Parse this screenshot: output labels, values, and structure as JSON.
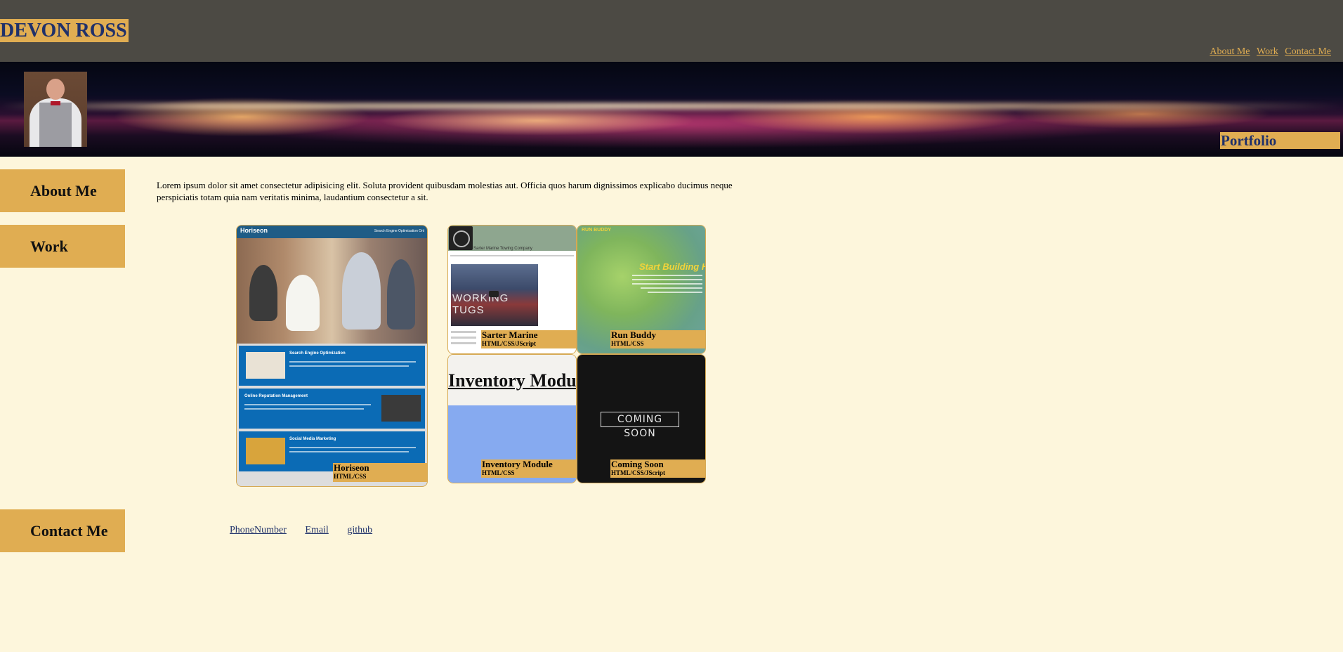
{
  "header": {
    "brand": "DEVON ROSS",
    "nav": [
      {
        "label": "About Me"
      },
      {
        "label": "Work"
      },
      {
        "label": "Contact Me"
      }
    ]
  },
  "banner": {
    "section_label": "Portfolio"
  },
  "sidebar": {
    "about": "About Me",
    "work": "Work",
    "contact": "Contact Me"
  },
  "about": {
    "text": "Lorem ipsum dolor sit amet consectetur adipisicing elit. Soluta provident quibusdam molestias aut. Officia quos harum dignissimos explicabo ducimus neque perspiciatis totam quia nam veritatis minima, laudantium consectetur a sit."
  },
  "work": {
    "projects": [
      {
        "title": "Horiseon",
        "tech": "HTML/CSS",
        "preview": {
          "brand": "Horiseon",
          "nav_text": "Search Engine Optimization   Onl",
          "sections": [
            "Search Engine Optimization",
            "Online Reputation Management",
            "Social Media Marketing"
          ]
        }
      },
      {
        "title": "Sarter Marine",
        "tech": "HTML/CSS/JScript",
        "preview": {
          "company": "Sarter Marine Towing Company",
          "video_text": "WORKING TUGS"
        }
      },
      {
        "title": "Run Buddy",
        "tech": "HTML/CSS",
        "preview": {
          "logo": "RUN BUDDY",
          "headline": "Start Building H"
        }
      },
      {
        "title": "Inventory Module",
        "tech": "HTML/CSS",
        "preview": {
          "heading": "Inventory Modu"
        }
      },
      {
        "title": "Coming Soon",
        "tech": "HTML/CSS/JScript",
        "preview": {
          "text": "COMING SOON"
        }
      }
    ]
  },
  "contact": {
    "links": [
      {
        "label": "PhoneNumber"
      },
      {
        "label": "Email"
      },
      {
        "label": "github"
      }
    ]
  },
  "colors": {
    "page_bg": "#fdf6dc",
    "header_bg": "#4c4a44",
    "accent": "#e0ad52",
    "brand_text": "#20316a"
  }
}
